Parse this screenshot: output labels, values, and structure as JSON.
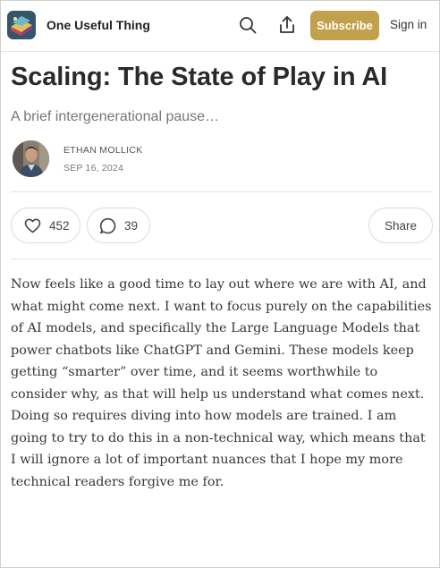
{
  "header": {
    "publication_name": "One Useful Thing",
    "subscribe_label": "Subscribe",
    "signin_label": "Sign in",
    "accent_color": "#c2a14d"
  },
  "post": {
    "title": "Scaling: The State of Play in AI",
    "subtitle": "A brief intergenerational pause…",
    "author": "ETHAN MOLLICK",
    "date": "SEP 16, 2024"
  },
  "actions": {
    "likes": "452",
    "comments": "39",
    "share_label": "Share"
  },
  "body": {
    "paragraph": "Now feels like a good time to lay out where we are with AI, and what might come next. I want to focus purely on the capabilities of AI models, and specifically the Large Language Models that power chatbots like ChatGPT and Gemini. These models keep getting “smarter” over time, and it seems worthwhile to consider why, as that will help us understand what comes next. Doing so requires diving into how models are trained. I am going to try to do this in a non-technical way, which means that I will ignore a lot of important nuances that I hope my more technical readers forgive me for."
  },
  "icons": [
    "publication-logo",
    "search-icon",
    "share-icon",
    "heart-icon",
    "comment-icon"
  ]
}
